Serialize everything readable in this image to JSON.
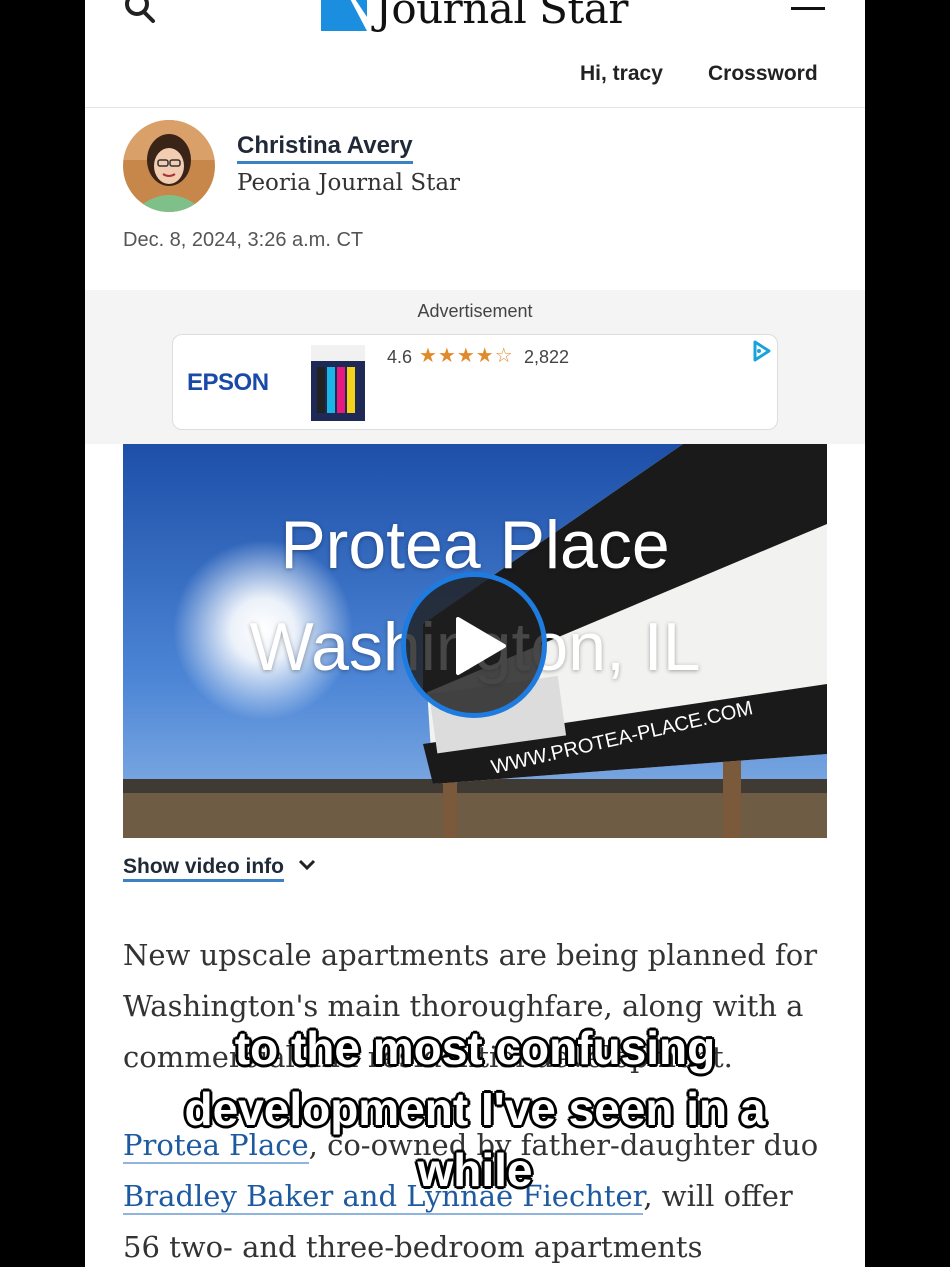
{
  "header": {
    "logo_text": "Journal Star",
    "user_greeting": "Hi, tracy",
    "crossword_label": "Crossword",
    "icons": [
      "search-icon",
      "logo-icon",
      "hamburger-menu-icon"
    ]
  },
  "byline": {
    "author_name": "Christina Avery",
    "organization": "Peoria Journal Star",
    "date": "Dec. 8, 2024, 3:26 a.m. CT"
  },
  "ad": {
    "label": "Advertisement",
    "brand": "EPSON",
    "rating": "4.6",
    "stars": "★★★★☆",
    "review_count": "2,822"
  },
  "video": {
    "title_line1": "Protea Place",
    "title_line2": "Washington, IL",
    "sign_url": "WWW.PROTEA-PLACE.COM",
    "info_label": "Show video info"
  },
  "article": {
    "p1": "New upscale apartments are being planned for Washington's main thoroughfare, along with a commercial and residential development.",
    "p2_link1": "Protea Place",
    "p2_mid": ", co-owned by father-daughter duo ",
    "p2_link2": "Bradley Baker and Lynnae Fiechter",
    "p2_end": ", will offer 56 two- and three-bedroom apartments"
  },
  "caption": {
    "line1": "to the most confusing",
    "line2": "development I've seen in a",
    "line3": "while"
  },
  "colors": {
    "link_underline": "#3b82c4",
    "article_link": "#1d5aa0",
    "play_ring": "#1e7be0",
    "logo_blue": "#1b8ee0",
    "epson_blue": "#1a4aa8",
    "star_orange": "#e08a2c"
  }
}
